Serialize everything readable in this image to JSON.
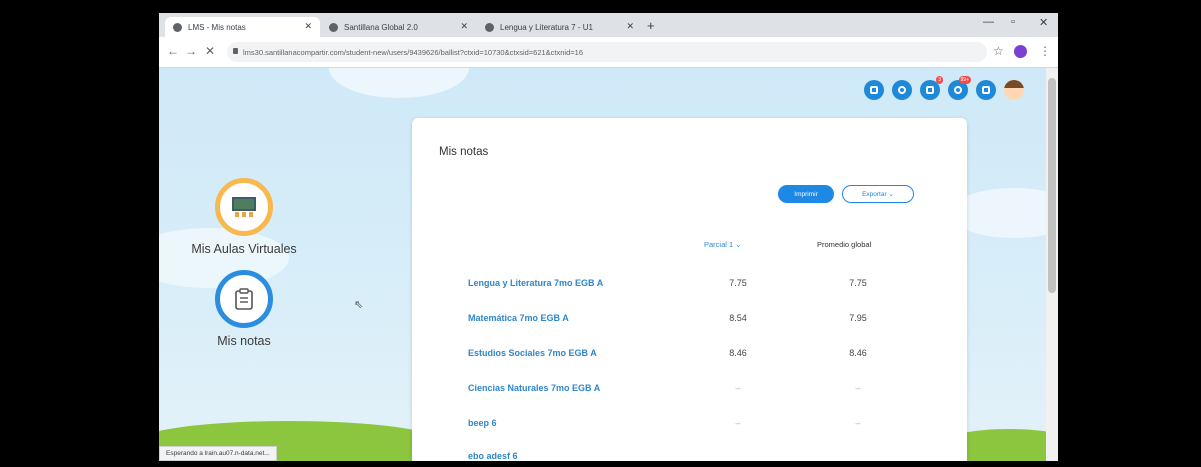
{
  "browser": {
    "tabs": [
      {
        "title": "LMS - Mis notas",
        "active": true
      },
      {
        "title": "Santillana Global 2.0",
        "active": false
      },
      {
        "title": "Lengua y Literatura 7 - U1",
        "active": false
      }
    ],
    "url": "lms30.santillanacompartir.com/student-new/users/9439626/ballist?ctxid=10730&ctxsid=621&ctxnid=16",
    "status": "Esperando a lrain.au07.n-data.net..."
  },
  "header": {
    "badges": {
      "messages": "3",
      "notifications": "99+"
    }
  },
  "sidebar": {
    "items": [
      {
        "label": "Mis Aulas Virtuales"
      },
      {
        "label": "Mis notas"
      }
    ]
  },
  "grades": {
    "title": "Mis notas",
    "print_label": "Imprimir",
    "export_label": "Exportar ⌄",
    "col_partial": "Parcial 1 ⌄",
    "col_average": "Promedio global",
    "rows": [
      {
        "subject": "Lengua y Literatura 7mo EGB A",
        "partial": "7.75",
        "average": "7.75"
      },
      {
        "subject": "Matemática 7mo EGB A",
        "partial": "8.54",
        "average": "7.95"
      },
      {
        "subject": "Estudios Sociales 7mo EGB A",
        "partial": "8.46",
        "average": "8.46"
      },
      {
        "subject": "Ciencias Naturales 7mo EGB A",
        "partial": "–",
        "average": "–"
      },
      {
        "subject": "beep 6",
        "partial": "–",
        "average": "–"
      },
      {
        "subject": "ebo adesf 6",
        "partial": "",
        "average": ""
      }
    ]
  },
  "colors": {
    "accent": "#1e88e5",
    "link": "#2f86c9",
    "orange": "#f7b84e",
    "grass": "#8cc63f"
  }
}
